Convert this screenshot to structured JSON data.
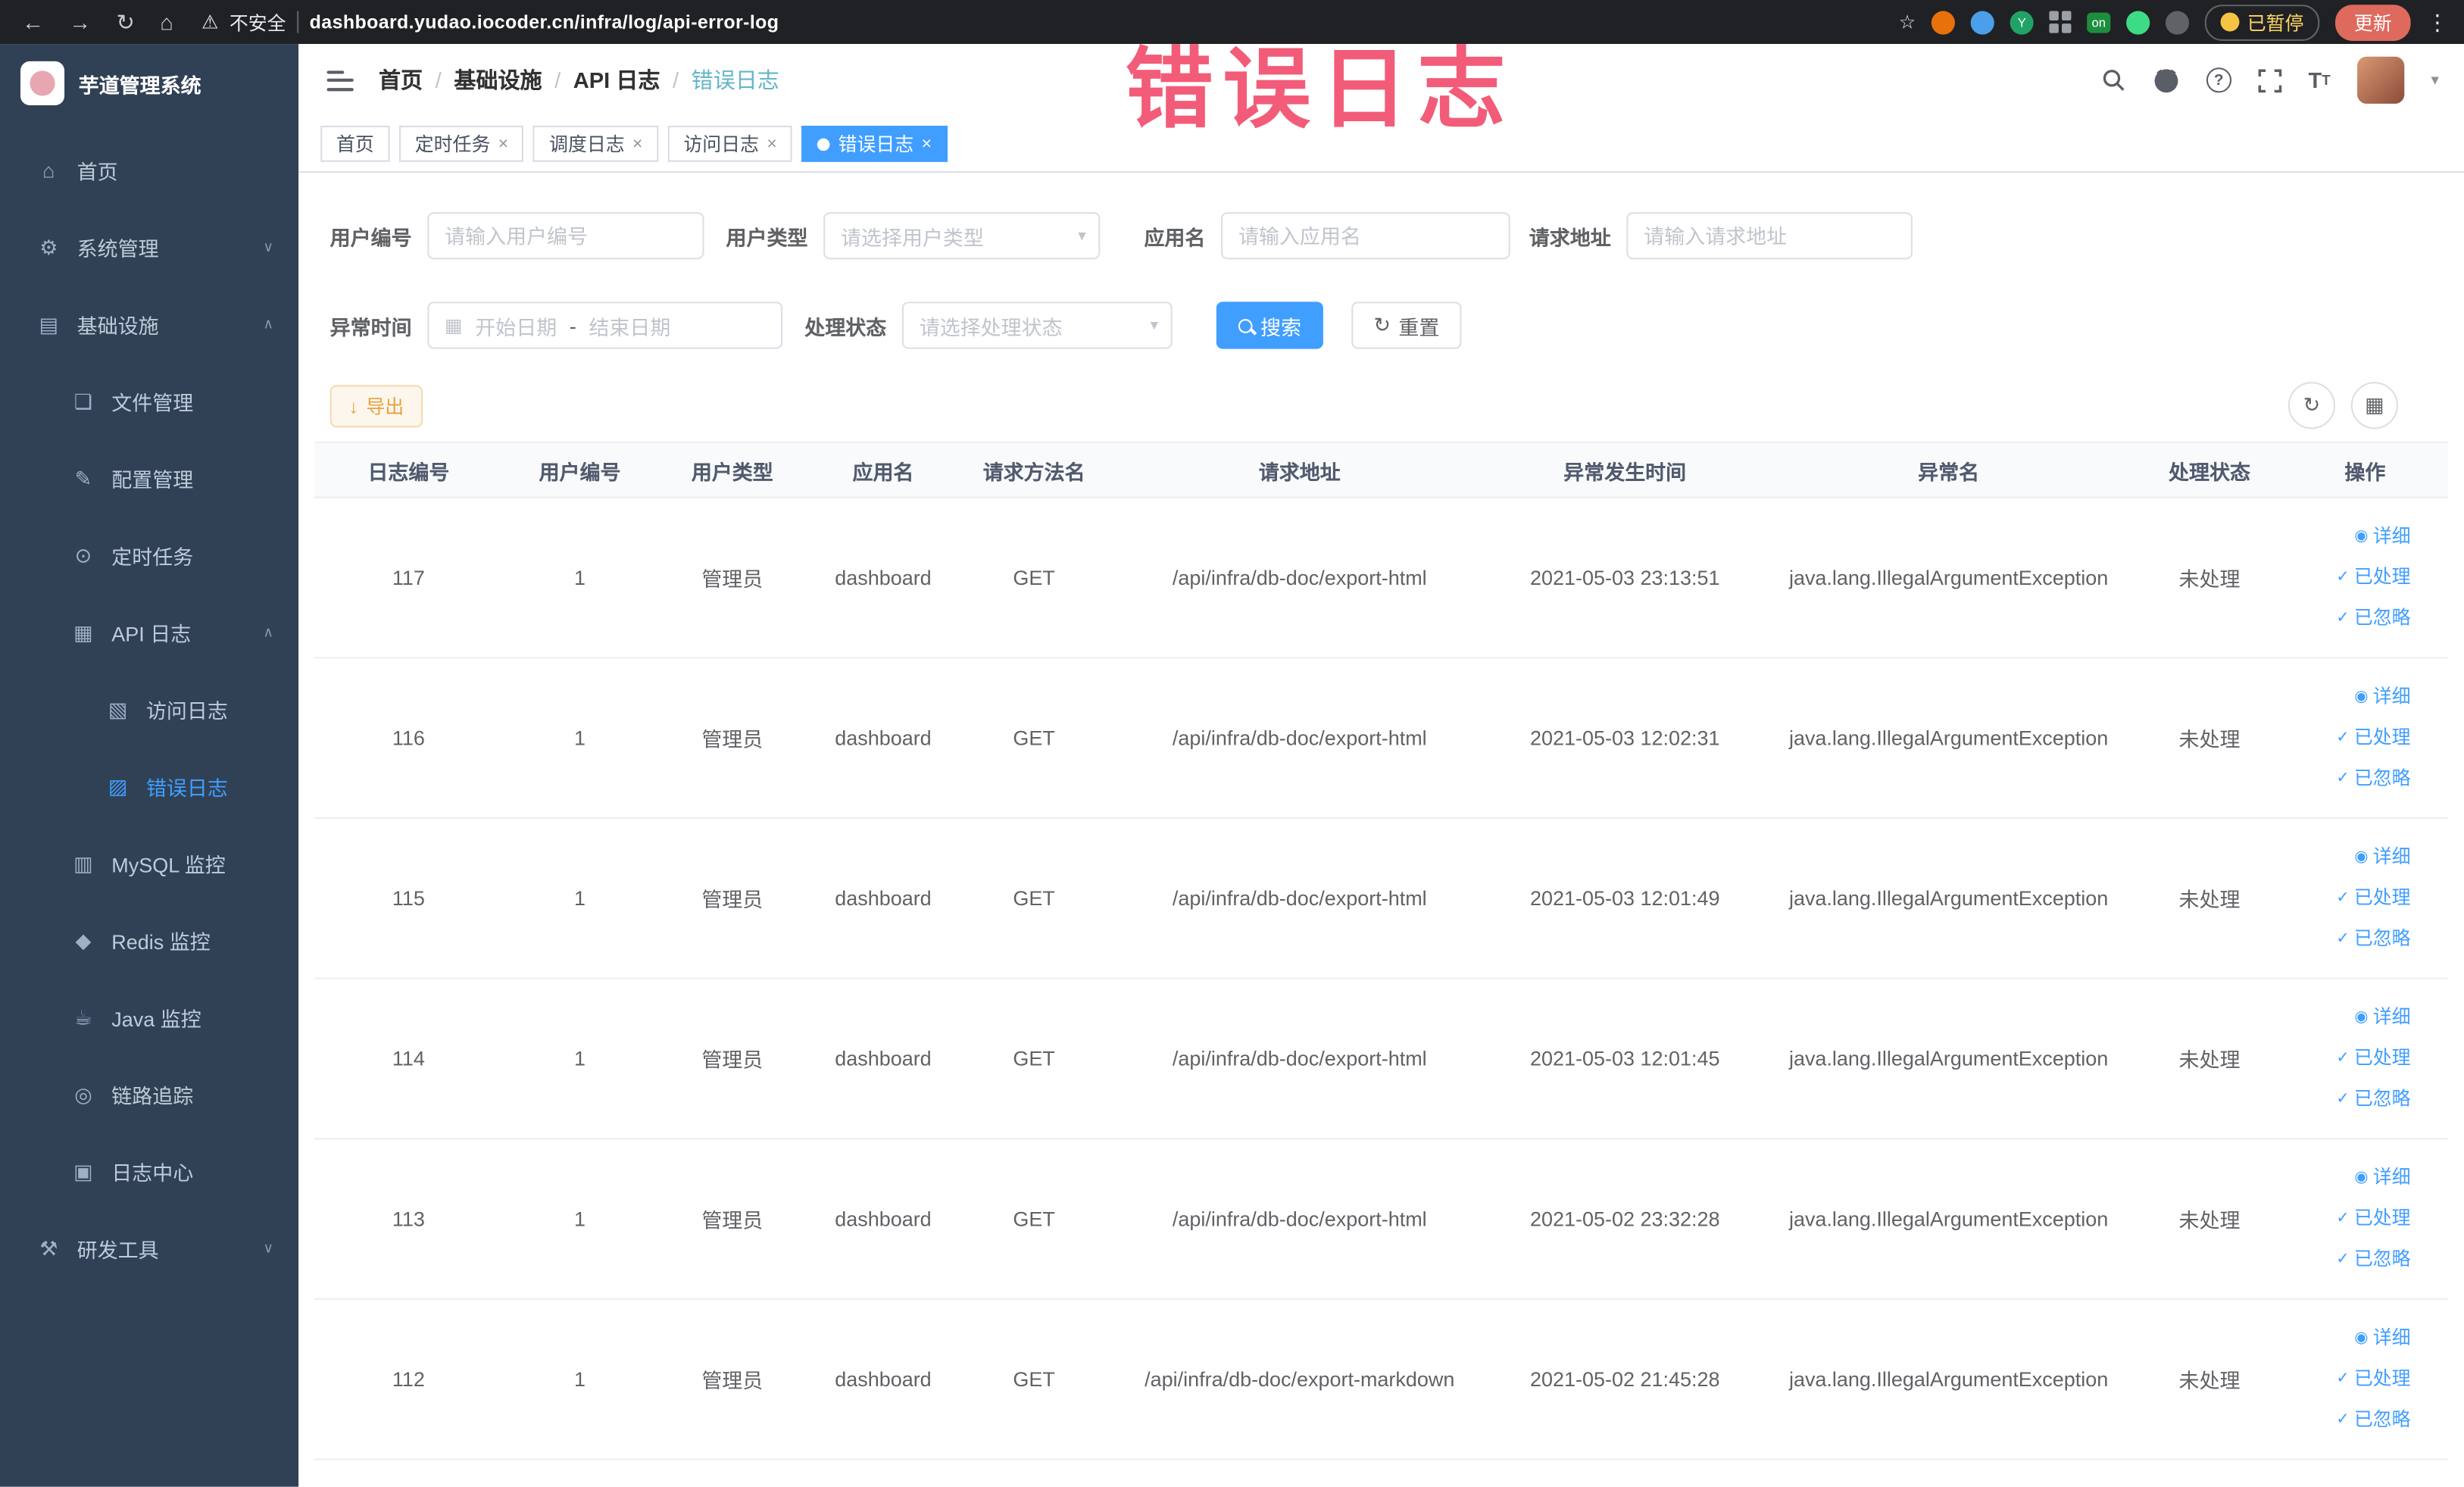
{
  "annotation": {
    "text": "错误日志"
  },
  "browser": {
    "security_label": "不安全",
    "url": "dashboard.yudao.iocoder.cn/infra/log/api-error-log",
    "paused_badge": "已暂停",
    "update_button": "更新",
    "ext_on_badge": "on",
    "ext_letter_badge": "Y"
  },
  "icons": {
    "back": "←",
    "forward": "→",
    "reload": "↻",
    "home": "⌂",
    "warning": "⚠",
    "star": "☆",
    "menu_dots": "⋮",
    "sidebar_home": "⌂",
    "gear": "⚙",
    "infra": "▤",
    "file": "❏",
    "config": "✎",
    "timer": "⊙",
    "api": "▦",
    "access_log": "▧",
    "error_log": "▨",
    "mysql": "▥",
    "redis": "◆",
    "java": "☕",
    "trace": "◎",
    "log_center": "▣",
    "devtools": "⚒",
    "chevron_down": "∨",
    "chevron_up": "∧",
    "caret_down": "▾",
    "calendar": "▦",
    "close": "×",
    "check": "✓",
    "detail": "◉",
    "download": "↓",
    "refresh": "↻",
    "columns": "▦",
    "question_mark": "?",
    "caret": "▾"
  },
  "sidebar": {
    "logo_title": "芋道管理系统",
    "items": [
      {
        "label": "首页"
      },
      {
        "label": "系统管理"
      },
      {
        "label": "基础设施"
      },
      {
        "label": "文件管理"
      },
      {
        "label": "配置管理"
      },
      {
        "label": "定时任务"
      },
      {
        "label": "API 日志"
      },
      {
        "label": "访问日志"
      },
      {
        "label": "错误日志"
      },
      {
        "label": "MySQL 监控"
      },
      {
        "label": "Redis 监控"
      },
      {
        "label": "Java 监控"
      },
      {
        "label": "链路追踪"
      },
      {
        "label": "日志中心"
      },
      {
        "label": "研发工具"
      }
    ]
  },
  "header": {
    "breadcrumbs": [
      "首页",
      "基础设施",
      "API 日志",
      "错误日志"
    ],
    "fontsize_icon": "T"
  },
  "tabs": [
    {
      "label": "首页"
    },
    {
      "label": "定时任务"
    },
    {
      "label": "调度日志"
    },
    {
      "label": "访问日志"
    },
    {
      "label": "错误日志"
    }
  ],
  "filters": {
    "user_id_label": "用户编号",
    "user_id_placeholder": "请输入用户编号",
    "user_type_label": "用户类型",
    "user_type_placeholder": "请选择用户类型",
    "app_name_label": "应用名",
    "app_name_placeholder": "请输入应用名",
    "request_url_label": "请求地址",
    "request_url_placeholder": "请输入请求地址",
    "exception_time_label": "异常时间",
    "start_date_placeholder": "开始日期",
    "date_separator": "-",
    "end_date_placeholder": "结束日期",
    "process_status_label": "处理状态",
    "process_status_placeholder": "请选择处理状态",
    "search_button": "搜索",
    "reset_button": "重置"
  },
  "toolbar": {
    "export_button": "导出"
  },
  "table": {
    "columns": [
      "日志编号",
      "用户编号",
      "用户类型",
      "应用名",
      "请求方法名",
      "请求地址",
      "异常发生时间",
      "异常名",
      "处理状态",
      "操作"
    ],
    "action_labels": {
      "detail": "详细",
      "processed": "已处理",
      "ignored": "已忽略"
    },
    "rows": [
      {
        "id": "117",
        "user_id": "1",
        "user_type": "管理员",
        "app": "dashboard",
        "method": "GET",
        "url": "/api/infra/db-doc/export-html",
        "time": "2021-05-03 23:13:51",
        "exception": "java.lang.IllegalArgumentException",
        "status": "未处理"
      },
      {
        "id": "116",
        "user_id": "1",
        "user_type": "管理员",
        "app": "dashboard",
        "method": "GET",
        "url": "/api/infra/db-doc/export-html",
        "time": "2021-05-03 12:02:31",
        "exception": "java.lang.IllegalArgumentException",
        "status": "未处理"
      },
      {
        "id": "115",
        "user_id": "1",
        "user_type": "管理员",
        "app": "dashboard",
        "method": "GET",
        "url": "/api/infra/db-doc/export-html",
        "time": "2021-05-03 12:01:49",
        "exception": "java.lang.IllegalArgumentException",
        "status": "未处理"
      },
      {
        "id": "114",
        "user_id": "1",
        "user_type": "管理员",
        "app": "dashboard",
        "method": "GET",
        "url": "/api/infra/db-doc/export-html",
        "time": "2021-05-03 12:01:45",
        "exception": "java.lang.IllegalArgumentException",
        "status": "未处理"
      },
      {
        "id": "113",
        "user_id": "1",
        "user_type": "管理员",
        "app": "dashboard",
        "method": "GET",
        "url": "/api/infra/db-doc/export-html",
        "time": "2021-05-02 23:32:28",
        "exception": "java.lang.IllegalArgumentException",
        "status": "未处理"
      },
      {
        "id": "112",
        "user_id": "1",
        "user_type": "管理员",
        "app": "dashboard",
        "method": "GET",
        "url": "/api/infra/db-doc/export-markdown",
        "time": "2021-05-02 21:45:28",
        "exception": "java.lang.IllegalArgumentException",
        "status": "未处理"
      }
    ]
  },
  "colors": {
    "accent": "#409EFF",
    "sidebar_bg": "#304156",
    "annotation": "#f2506e",
    "warning_btn": "#e6a23c"
  }
}
